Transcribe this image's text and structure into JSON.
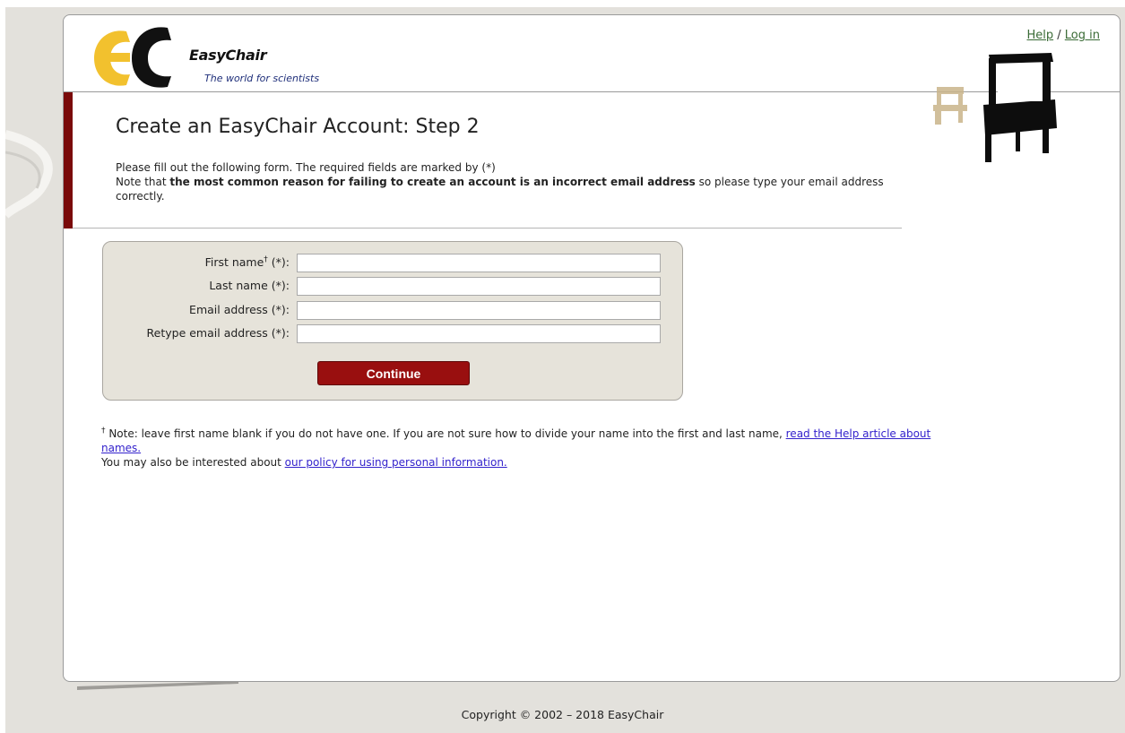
{
  "header": {
    "logo_title": "EasyChair",
    "logo_subtitle": "The world for scientists",
    "help_link": "Help",
    "separator": "/",
    "login_link": "Log in"
  },
  "main": {
    "title": "Create an EasyChair Account: Step 2",
    "intro_line1": "Please fill out the following form. The required fields are marked by (*)",
    "intro_note_prefix": "Note that ",
    "intro_note_bold": "the most common reason for failing to create an account is an incorrect email address",
    "intro_note_suffix": " so please type your email address correctly."
  },
  "form": {
    "first_name_label": "First name",
    "first_name_mark": "†",
    "first_name_required": " (*):",
    "last_name_label": "Last name (*):",
    "email_label": "Email address (*):",
    "retype_email_label": "Retype email address (*):",
    "first_name_value": "",
    "last_name_value": "",
    "email_value": "",
    "retype_email_value": "",
    "continue_label": "Continue"
  },
  "footnote": {
    "mark": "†",
    "text": " Note: leave first name blank if you do not have one. If you are not sure how to divide your name into the first and last name, ",
    "help_link": "read the Help article about names.",
    "policy_prefix": "You may also be interested about ",
    "policy_link": "our policy for using personal information."
  },
  "footer": {
    "copyright": "Copyright © 2002 – 2018 EasyChair"
  },
  "colors": {
    "accent_red": "#990f0f",
    "sidebar_red": "#7a0a0a",
    "form_bg": "#e6e3da",
    "link_blue": "#3322cc",
    "link_green": "#3a6b36",
    "logo_yellow": "#f2c12e"
  }
}
